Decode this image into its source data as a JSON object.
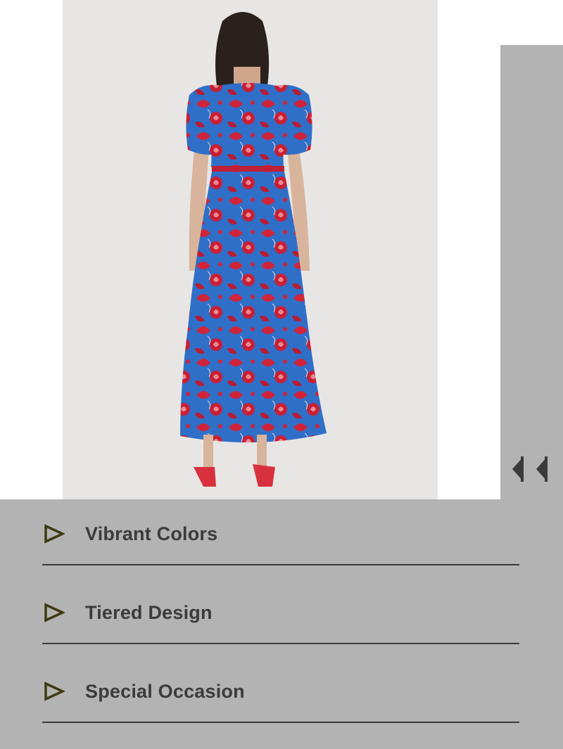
{
  "product_image": {
    "description_icon": "dress-photo",
    "colors": {
      "background": "#e8e6e5",
      "dress_blue": "#2f6fc8",
      "dress_red": "#d0243a",
      "hair": "#2a211d",
      "skin": "#d8b49c",
      "shoes": "#d8313d"
    }
  },
  "gallery_nav": {
    "prev_icon": "double-chevron-left-icon"
  },
  "features": {
    "items": [
      {
        "label": "Vibrant Colors",
        "icon": "play-triangle-icon"
      },
      {
        "label": "Tiered Design",
        "icon": "play-triangle-icon"
      },
      {
        "label": "Special Occasion",
        "icon": "play-triangle-icon"
      }
    ],
    "colors": {
      "panel": "#b4b3b4",
      "text": "#3b3b3b",
      "icon": "#3d3a12",
      "divider": "#3a3a3a"
    }
  }
}
